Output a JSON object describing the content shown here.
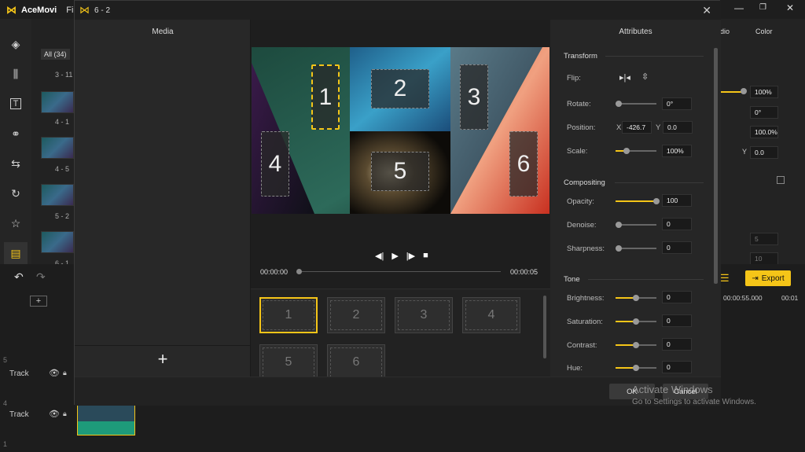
{
  "app": {
    "name": "AceMovi",
    "menu_file": "Fil"
  },
  "background": {
    "filter_all": "All (34)",
    "thumb_labels": [
      "3 - 11",
      "4 - 1",
      "4 - 5",
      "5 - 2",
      "6 - 1"
    ],
    "right_tabs": [
      "dio",
      "Color"
    ],
    "right_values": [
      "100%",
      "0°",
      "100.0%",
      "0.0"
    ],
    "right_y_label": "Y",
    "right_grey_values": [
      "5",
      "10"
    ],
    "export_label": "Export",
    "time_marker_1": "00:00:55.000",
    "time_marker_2": "00:01",
    "track_label": "Track",
    "track_numbers": [
      "5",
      "4",
      "1"
    ]
  },
  "dialog": {
    "title": "6 - 2",
    "media_title": "Media",
    "attributes_title": "Attributes",
    "slots": [
      "1",
      "2",
      "3",
      "4",
      "5",
      "6"
    ],
    "time_start": "00:00:00",
    "time_end": "00:00:05",
    "templates": [
      "1",
      "2",
      "3",
      "4",
      "5",
      "6"
    ],
    "ok_label": "OK",
    "cancel_label": "Cancel"
  },
  "attributes": {
    "transform_label": "Transform",
    "flip_label": "Flip:",
    "rotate_label": "Rotate:",
    "rotate_value": "0°",
    "position_label": "Position:",
    "pos_x_label": "X",
    "pos_x": "-426.7",
    "pos_y_label": "Y",
    "pos_y": "0.0",
    "scale_label": "Scale:",
    "scale_value": "100%",
    "compositing_label": "Compositing",
    "opacity_label": "Opacity:",
    "opacity_value": "100",
    "denoise_label": "Denoise:",
    "denoise_value": "0",
    "sharpness_label": "Sharpness:",
    "sharpness_value": "0",
    "tone_label": "Tone",
    "brightness_label": "Brightness:",
    "brightness_value": "0",
    "saturation_label": "Saturation:",
    "saturation_value": "0",
    "contrast_label": "Contrast:",
    "contrast_value": "0",
    "hue_label": "Hue:",
    "hue_value": "0"
  },
  "watermark": {
    "line1": "Activate Windows",
    "line2": "Go to Settings to activate Windows."
  },
  "colors": {
    "accent": "#f5c518",
    "background": "#262626"
  }
}
